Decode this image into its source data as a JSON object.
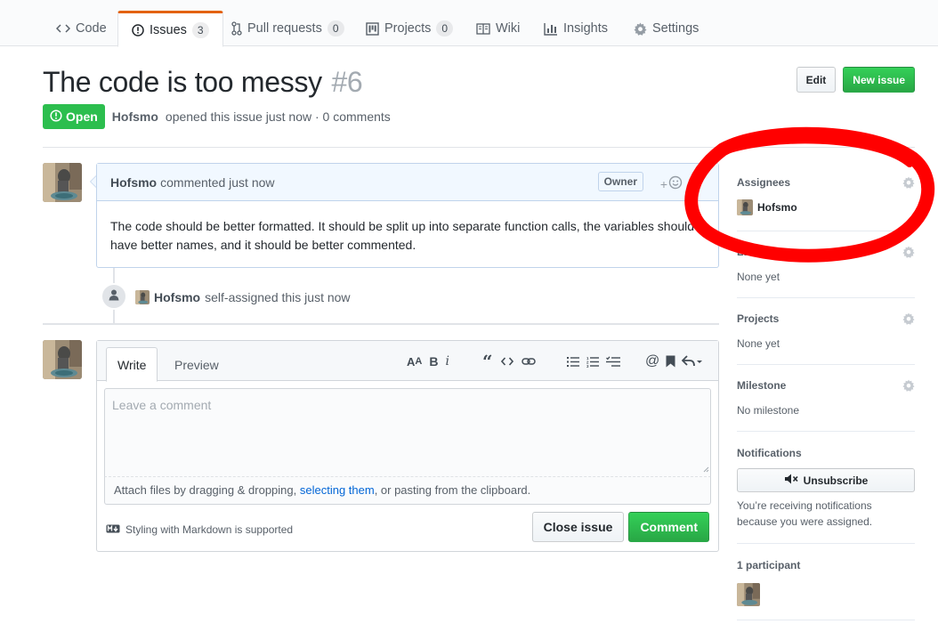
{
  "tabs": [
    {
      "label": "Code",
      "icon": "code-icon"
    },
    {
      "label": "Issues",
      "icon": "issue-opened-icon",
      "count": "3",
      "selected": true
    },
    {
      "label": "Pull requests",
      "icon": "git-pull-request-icon",
      "count": "0"
    },
    {
      "label": "Projects",
      "icon": "project-icon",
      "count": "0"
    },
    {
      "label": "Wiki",
      "icon": "book-icon"
    },
    {
      "label": "Insights",
      "icon": "graph-icon"
    },
    {
      "label": "Settings",
      "icon": "gear-icon"
    }
  ],
  "issue": {
    "title": "The code is too messy",
    "number": "#6",
    "state": "Open",
    "author": "Hofsmo",
    "meta": "opened this issue just now · 0 comments",
    "edit_label": "Edit",
    "new_issue_label": "New issue"
  },
  "comment": {
    "author": "Hofsmo",
    "meta": "commented just now",
    "role": "Owner",
    "body": "The code should be better formatted. It should be split up into separate function calls, the variables should have better names, and it should be better commented."
  },
  "event": {
    "actor": "Hofsmo",
    "text": "self-assigned this just now"
  },
  "form": {
    "write_tab": "Write",
    "preview_tab": "Preview",
    "placeholder": "Leave a comment",
    "attach_prefix": "Attach files by dragging & dropping, ",
    "attach_link": "selecting them",
    "attach_suffix": ", or pasting from the clipboard.",
    "markdown_note": "Styling with Markdown is supported",
    "close_label": "Close issue",
    "comment_label": "Comment"
  },
  "sidebar": {
    "assignees_heading": "Assignees",
    "assignee": "Hofsmo",
    "labels_heading": "Labels",
    "labels_value": "None yet",
    "projects_heading": "Projects",
    "projects_value": "None yet",
    "milestone_heading": "Milestone",
    "milestone_value": "No milestone",
    "notifications_heading": "Notifications",
    "unsubscribe_label": "Unsubscribe",
    "notifications_note": "You’re receiving notifications because you were assigned.",
    "participants_heading": "1 participant"
  },
  "colors": {
    "open_green": "#2cbe4e",
    "primary_green": "#28a745",
    "tab_accent": "#e36209",
    "annotation_red": "#ff0000",
    "link_blue": "#0366d6"
  }
}
